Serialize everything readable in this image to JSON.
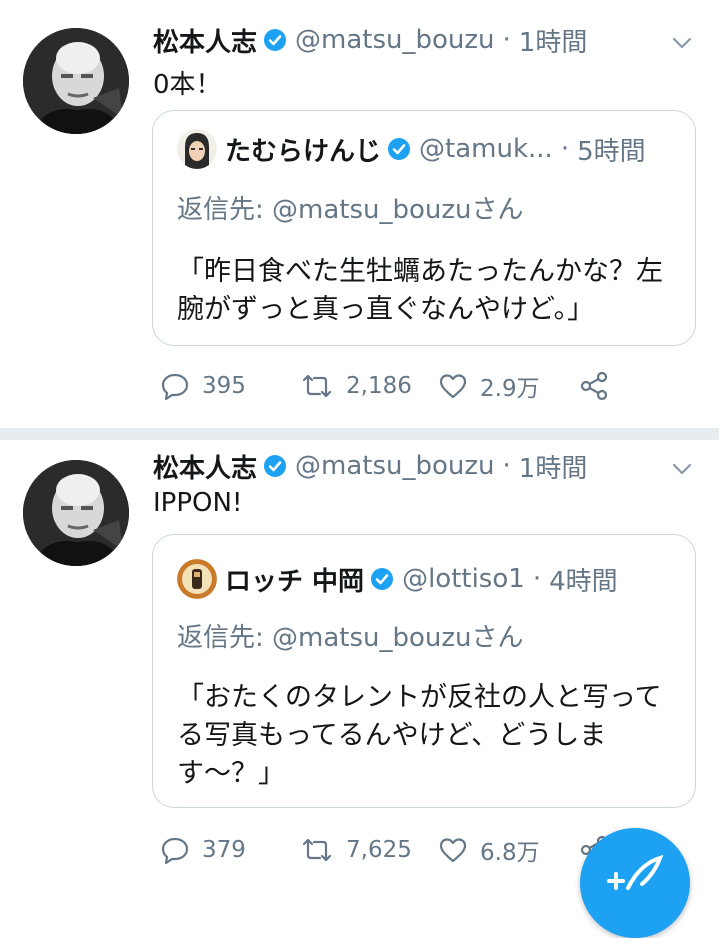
{
  "colors": {
    "accent": "#1da1f2",
    "text_primary": "#14171a",
    "text_secondary": "#657786",
    "border": "#ccd6dd",
    "divider": "#e6ecf0"
  },
  "tweets": [
    {
      "author_name": "松本人志",
      "handle": "@matsu_bouzu",
      "separator": "·",
      "time": "1時間",
      "text": "0本！",
      "quote": {
        "author_name": "たむらけんじ",
        "handle": "@tamuk...",
        "separator": "·",
        "time": "5時間",
        "reply_prefix": "返信先: ",
        "reply_handle": "@matsu_bouzuさん",
        "text": "「昨日食べた生牡蠣あたったんかな？左腕がずっと真っ直ぐなんやけど。」"
      },
      "stats": {
        "replies": "395",
        "retweets": "2,186",
        "likes": "2.9万"
      }
    },
    {
      "author_name": "松本人志",
      "handle": "@matsu_bouzu",
      "separator": "·",
      "time": "1時間",
      "text": "IPPON!",
      "quote": {
        "author_name": "ロッチ 中岡",
        "handle": "@lottiso1",
        "separator": "·",
        "time": "4時間",
        "reply_prefix": "返信先: ",
        "reply_handle": "@matsu_bouzuさん",
        "text": "「おたくのタレントが反社の人と写ってる写真もってるんやけど、どうしま す〜？」"
      },
      "stats": {
        "replies": "379",
        "retweets": "7,625",
        "likes": "6.8万"
      }
    }
  ],
  "icons": {
    "verified": "verified-badge-icon",
    "caret": "chevron-down-icon",
    "reply": "reply-icon",
    "retweet": "retweet-icon",
    "like": "heart-icon",
    "share": "share-icon",
    "compose": "compose-tweet-icon"
  }
}
